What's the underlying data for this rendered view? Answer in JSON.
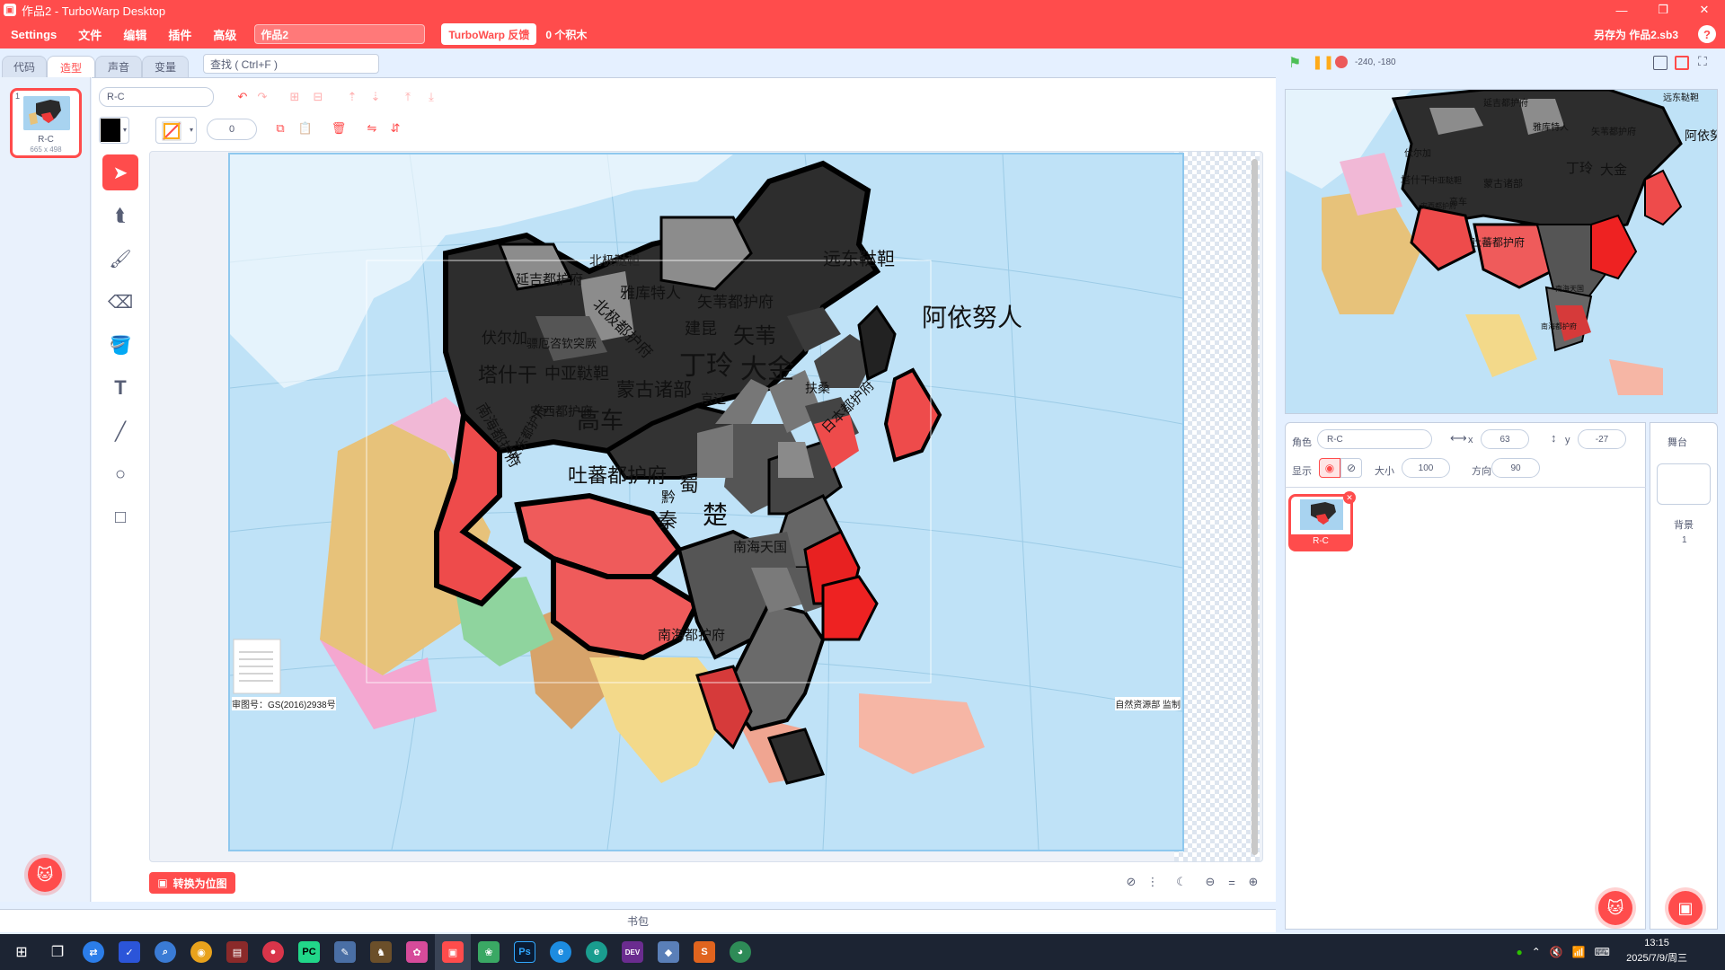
{
  "window": {
    "title": "作品2 - TurboWarp Desktop",
    "app_icon": "turbowarp-icon",
    "controls": [
      "—",
      "❐",
      "✕"
    ]
  },
  "menubar": {
    "items": [
      "Settings",
      "文件",
      "编辑",
      "插件",
      "高级"
    ],
    "project_title": "作品2",
    "feedback_label": "TurboWarp 反馈",
    "blocks_count": "0 个积木",
    "save_as": "另存为 作品2.sb3",
    "help": "?"
  },
  "tabs": [
    {
      "label": "代码",
      "active": false
    },
    {
      "label": "造型",
      "active": true
    },
    {
      "label": "声音",
      "active": false
    },
    {
      "label": "变量",
      "active": false
    }
  ],
  "find": {
    "placeholder": "查找 ( Ctrl+F )"
  },
  "costumes": [
    {
      "index": "1",
      "name": "R-C",
      "size": "665 x 498"
    }
  ],
  "paint": {
    "costume_name": "R-C",
    "stroke_width": "0",
    "fill_color": "#000000",
    "convert_label": "转换为位图",
    "tools": [
      "select-icon",
      "reshape-icon",
      "brush-icon",
      "eraser-icon",
      "fill-icon",
      "text-icon",
      "line-icon",
      "circle-icon",
      "rectangle-icon"
    ]
  },
  "map": {
    "labels": [
      "远东鞑靼",
      "阿依努人",
      "延吉都护府",
      "北极鞑靼",
      "雅库特人",
      "矢苇都护府",
      "北极都护府",
      "伏尔加",
      "建昆",
      "矢苇",
      "骠厄咨钦突厥",
      "塔什干",
      "中亚鞑靼",
      "丁玲",
      "大金",
      "蒙古诸部",
      "安西都护府",
      "高车",
      "京辽",
      "安东都护府",
      "日本都护府",
      "南海都护府",
      "吐蕃都护府",
      "蜀",
      "秦",
      "黔",
      "楚",
      "南海天国",
      "南海都护府",
      "扶桑"
    ],
    "footer_left": "审图号：GS(2016)2938号",
    "footer_right": "自然资源部 监制"
  },
  "stage": {
    "coords": "-240, -180"
  },
  "sprite": {
    "label_sprite": "角色",
    "name": "R-C",
    "x_label": "x",
    "x": "63",
    "y_label": "y",
    "y": "-27",
    "show_label": "显示",
    "size_label": "大小",
    "size": "100",
    "direction_label": "方向",
    "direction": "90",
    "card_name": "R-C"
  },
  "stage_pane": {
    "title": "舞台",
    "backdrop_label": "背景",
    "backdrop_count": "1"
  },
  "backpack": {
    "label": "书包"
  },
  "taskbar": {
    "time": "13:15",
    "date": "2025/7/9/周三",
    "apps": [
      {
        "name": "windows-icon",
        "color": "#1c2433"
      },
      {
        "name": "taskview-icon",
        "color": "#1c2433"
      },
      {
        "name": "teamviewer-icon",
        "color": "#2b7de9"
      },
      {
        "name": "shield-app-icon",
        "color": "#2b55d9"
      },
      {
        "name": "search-app-icon",
        "color": "#3a7bd5"
      },
      {
        "name": "chrome-icon",
        "color": "#e8a21c"
      },
      {
        "name": "winrar-icon",
        "color": "#8b2a2a"
      },
      {
        "name": "ball-app-icon",
        "color": "#d9354a"
      },
      {
        "name": "pycharm-icon",
        "color": "#21d789"
      },
      {
        "name": "notepad-icon",
        "color": "#4a6fa5"
      },
      {
        "name": "game-app-icon",
        "color": "#6b4f2a"
      },
      {
        "name": "paint-app-icon",
        "color": "#d64b9a"
      },
      {
        "name": "turbowarp-app-icon",
        "color": "#ff4c4c"
      },
      {
        "name": "gallery-app-icon",
        "color": "#3aa864"
      },
      {
        "name": "photoshop-icon",
        "color": "#0a1b33"
      },
      {
        "name": "ie-icon",
        "color": "#1d8ce0"
      },
      {
        "name": "edge-icon",
        "color": "#1a9d8f"
      },
      {
        "name": "devcpp-icon",
        "color": "#6a2c8f"
      },
      {
        "name": "cube-app-icon",
        "color": "#5a7fb8"
      },
      {
        "name": "sublime-icon",
        "color": "#e0641e"
      },
      {
        "name": "drive-app-icon",
        "color": "#2e8b57"
      }
    ]
  }
}
